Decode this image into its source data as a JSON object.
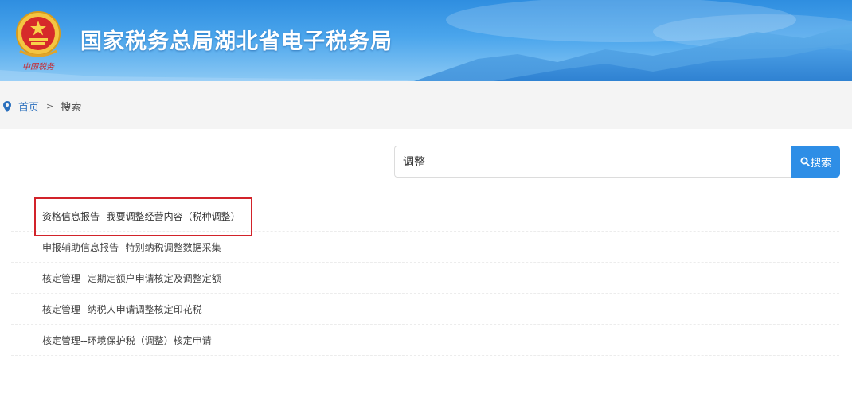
{
  "header": {
    "site_title": "国家税务总局湖北省电子税务局",
    "emblem_icon": "tax-emblem-icon",
    "emblem_caption": "中国税务",
    "colors": {
      "sky_top": "#2f8ee0",
      "sky_bottom": "#8cc9f4",
      "title_text": "#ffffff"
    }
  },
  "breadcrumb": {
    "icon": "location-pin-icon",
    "home": "首页",
    "separator": ">",
    "current": "搜索"
  },
  "search": {
    "value": "调整",
    "button_icon": "search-icon",
    "button_label": "搜索",
    "button_color": "#2e8ee6"
  },
  "results": [
    {
      "title": "资格信息报告--我要调整经营内容（税种调整）"
    },
    {
      "title": "申报辅助信息报告--特别纳税调整数据采集"
    },
    {
      "title": "核定管理--定期定额户申请核定及调整定额"
    },
    {
      "title": "核定管理--纳税人申请调整核定印花税"
    },
    {
      "title": "核定管理--环境保护税（调整）核定申请"
    }
  ],
  "annotation": {
    "highlight_color": "#d2232a"
  }
}
